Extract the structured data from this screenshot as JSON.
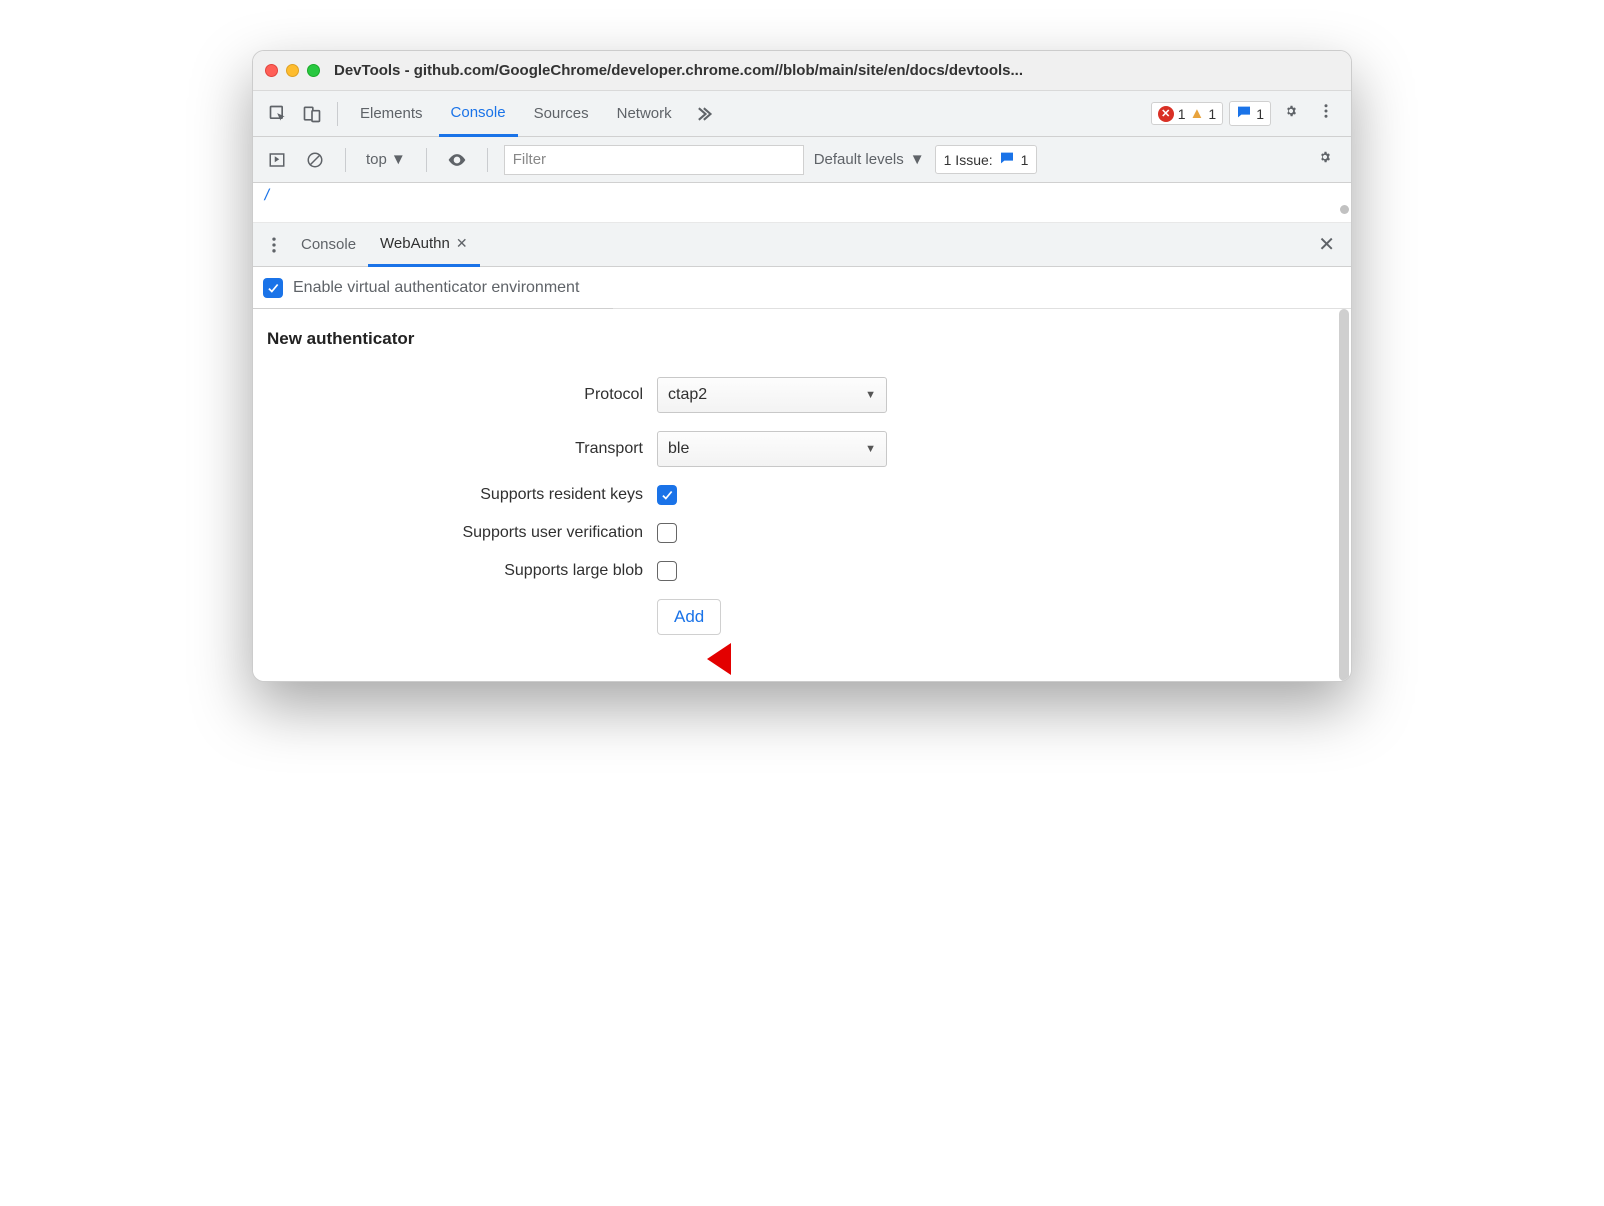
{
  "window": {
    "title": "DevTools - github.com/GoogleChrome/developer.chrome.com//blob/main/site/en/docs/devtools..."
  },
  "tabs": {
    "items": [
      "Elements",
      "Console",
      "Sources",
      "Network"
    ],
    "active": "Console"
  },
  "badges": {
    "errors": "1",
    "warnings": "1",
    "messages": "1"
  },
  "console_toolbar": {
    "context": "top",
    "filter_placeholder": "Filter",
    "levels": "Default levels",
    "issues_label": "1 Issue:",
    "issues_count": "1"
  },
  "drawer": {
    "tabs": [
      "Console",
      "WebAuthn"
    ],
    "active": "WebAuthn"
  },
  "webauthn": {
    "enable_label": "Enable virtual authenticator environment",
    "enable_checked": true,
    "section_title": "New authenticator",
    "fields": {
      "protocol": {
        "label": "Protocol",
        "value": "ctap2"
      },
      "transport": {
        "label": "Transport",
        "value": "ble"
      },
      "resident_keys": {
        "label": "Supports resident keys",
        "checked": true
      },
      "user_verification": {
        "label": "Supports user verification",
        "checked": false
      },
      "large_blob": {
        "label": "Supports large blob",
        "checked": false
      }
    },
    "add_button": "Add"
  }
}
